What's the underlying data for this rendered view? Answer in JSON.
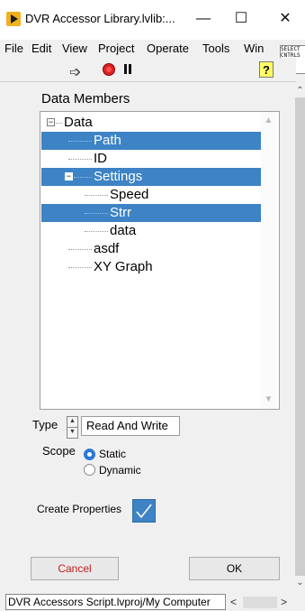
{
  "window": {
    "title": "DVR Accessor Library.lvlib:...",
    "minimize": "—",
    "maximize": "☐",
    "close": "✕"
  },
  "menu": {
    "items": [
      "File",
      "Edit",
      "View",
      "Project",
      "Operate",
      "Tools",
      "Win"
    ],
    "select_box_text": "SELECT CNTRLS 2"
  },
  "toolbar": {
    "run_icon": "run-arrow-icon",
    "help_label": "?"
  },
  "panel": {
    "section_title": "Data Members",
    "tree": [
      {
        "label": "Data",
        "expander": "⊟"
      },
      {
        "label": "Path",
        "selected": true
      },
      {
        "label": "ID"
      },
      {
        "label": "Settings",
        "expander": "⊟",
        "selected": true
      },
      {
        "label": "Speed"
      },
      {
        "label": "Strr",
        "selected": true
      },
      {
        "label": "data"
      },
      {
        "label": "asdf"
      },
      {
        "label": "XY Graph"
      }
    ],
    "type": {
      "label": "Type",
      "value": "Read And Write"
    },
    "scope": {
      "label": "Scope",
      "options": [
        "Static",
        "Dynamic"
      ],
      "selected": "Static"
    },
    "create_properties": {
      "label": "Create Properties",
      "checked": true
    },
    "cancel_label": "Cancel",
    "ok_label": "OK"
  },
  "status": {
    "path": "DVR Accessors Script.lvproj/My Computer",
    "scroll_left": "<",
    "scroll_right": ">"
  },
  "colors": {
    "selection": "#3d83c5",
    "cancel_text": "#c02020",
    "check_bg": "#3d83c5"
  }
}
